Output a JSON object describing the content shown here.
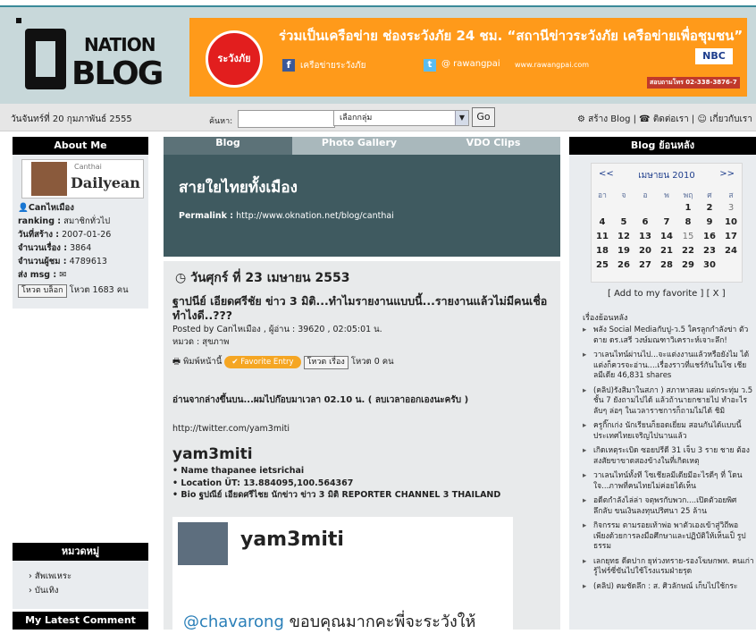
{
  "header": {
    "logo_nation": "NATION",
    "logo_blog": "BLOG",
    "banner_top": "ร่วมเป็นเครือข่าย ช่องระวังภัย 24 ชม. “สถานีข่าวระวังภัย เครือข่ายเพื่อชุมชน”",
    "banner_logo": "ระวังภัย",
    "banner_fb": "เครือข่ายระวังภัย",
    "banner_tw": "@ rawangpai",
    "banner_site": "www.rawangpai.com",
    "banner_nbc": "NBC",
    "banner_phone": "สอบถามโทร 02-338-3876-7"
  },
  "toolbar": {
    "date": "วันจันทร์ที่ 20 กุมภาพันธ์ 2555",
    "search_label": "ค้นหา:",
    "group_select": "เลือกกลุ่ม",
    "go": "Go",
    "link_create": "สร้าง Blog",
    "link_contact": "ติดต่อเรา",
    "link_about": "เกี่ยวกับเรา"
  },
  "left": {
    "about_title": "About Me",
    "profile_small": "Canthai",
    "profile_name_img": "Dailyean",
    "username": "Canไหเมือง",
    "ranking_label": "ranking :",
    "ranking_value": "สมาชิกทั่วไป",
    "created_label": "วันที่สร้าง :",
    "created_value": "2007-01-26",
    "posts_label": "จำนวนเรื่อง :",
    "posts_value": "3864",
    "visitors_label": "จำนวนผู้ชม :",
    "visitors_value": "4789613",
    "msg_label": "ส่ง msg :",
    "vote_button": "โหวต บล็อก",
    "vote_text": "โหวต 1683 คน",
    "category_title": "หมวดหมู่",
    "categories": [
      "สัพเพเหระ",
      "บันเทิง"
    ],
    "latest_title": "My Latest Comment"
  },
  "center": {
    "tabs": [
      "Blog",
      "Photo Gallery",
      "VDO Clips"
    ],
    "blog_title": "สายใยไทยทั้งเมือง",
    "permalink_label": "Permalink :",
    "permalink_url": "http://www.oknation.net/blog/canthai",
    "post_date": "วันศุกร์ ที่ 23 เมษายน 2553",
    "post_title": "ฐาปนีย์ เอียดศรีชัย ข่าว 3 มิติ...ทำไมรายงานแบบนี้...รายงานแล้วไม่มีคนเชื่อทำไงดี..???",
    "post_by": "Posted by Canไหเมือง , ผู้อ่าน : 39620 , 02:05:01 น.",
    "post_category": "หมวด : สุขภาพ",
    "print_label": "พิมพ์หน้านี้",
    "fav_entry": "Favorite Entry",
    "vote_story_button": "โหวต เรื่อง",
    "vote_story_text": "โหวต 0 คน",
    "body1": "อ่านจากล่างขึ้นบน...ผมไปก๊อบมาเวลา 02.10 น. ( ลบเวลาออกเองนะครับ )",
    "twitter_url": "http://twitter.com/yam3miti",
    "yam_head": "yam3miti",
    "yam_items": [
      "Name thapanee ietsrichai",
      "Location ÜT: 13.884095,100.564367",
      "Bio ฐปณีย์ เอียดศรีไชย นักข่าว ข่าว 3 มิติ REPORTER CHANNEL 3 THAILAND"
    ],
    "tweet_name": "yam3miti",
    "tweet_mention": "@chavarong",
    "tweet_text": " ขอบคุณมากคะพี่จะระวังให้"
  },
  "right": {
    "backlog_title": "Blog ย้อนหลัง",
    "cal_prev": "<<",
    "cal_month": "เมษายน 2010",
    "cal_next": ">>",
    "cal_days": [
      "อา",
      "จ",
      "อ",
      "พ",
      "พฤ",
      "ศ",
      "ส"
    ],
    "cal_weeks": [
      [
        "",
        "",
        "",
        "",
        "1",
        "2",
        "3"
      ],
      [
        "4",
        "5",
        "6",
        "7",
        "8",
        "9",
        "10"
      ],
      [
        "11",
        "12",
        "13",
        "14",
        "15",
        "16",
        "17"
      ],
      [
        "18",
        "19",
        "20",
        "21",
        "22",
        "23",
        "24"
      ],
      [
        "25",
        "26",
        "27",
        "28",
        "29",
        "30",
        ""
      ]
    ],
    "fav_links": "[ Add to my favorite ] [ X ]",
    "history_label": "เรื่องย้อนหลัง",
    "history": [
      "พลัง Social Mediaกับปู-ว.5 ใครลูกกำลังข่า ตัวตาย ดร.เสรี วงษ์มณฑาวิเคราะห์เจาะลึก!",
      "วาเลนไทน์ผ่านไป...จะแต่งงานแล้วหรือยังไม ได้แต่งก็ควรจะอ่าน....เรื่องราวที่แชร์กันในโซ เชียลมีเดีย 46,831 shares",
      "(คลิป)รังสิมาในสภา ) สภาหาสลม แต่กระทุ่ม ว.5 ชั้น 7 ยังถามไปได้ แล้วถ้านายกชายไป ทำอะไรลับๆ ล่อๆ ในเวลาราชการก็ถามไม่ได้ ชิมิ",
      "ครูกิ๊กเก่ง นักเรียนก็ยอดเยี่ยม สอนกันได้แบบนี้ ประเทศไทยเจริญไปนานแล้ว",
      "เกิดเหตุระเบิด ซอยปรีดี 31 เจ็บ 3 ราย ชาย ต้องสงสัยขาขาดสองข้างในที่เกิดเหตุ",
      "วาเลนไทน์ทั้งที โซเชียลมีเดียมีอะไรดีๆ ที่ โดนใจ...ภาพที่คนไทยไม่ค่อยได้เห็น",
      "อดีตกำลังไล่ล่า จตุพรกับพวก....เปิดตัวอยพิศ ลึกลับ ขนเงินลงทุนปริศนา 25 ล้าน",
      "กิจกรรม ตามรอยเท้าพ่อ พาตัวเองเข้าสู่วิถีพอ เพียงด้วยการลงมือศึกษาและปฏิบัติให้เห็นเป็ รูปธรรม",
      "เลกยุทธ ดีดปาก ยุห่วงทราย-รองโฆษกพท. คนเก่ารู้ไฟร์ซี่ขันไปใช้โรงแรมฝ่ายรุด",
      "(คลิป) คมชัดลึก : ส. ศิวลักษณ์ เก็บไปใช้กระ"
    ]
  },
  "colors": {
    "header_bg": "#c8d8da",
    "banner_bg": "#ff9a1a",
    "blog_header_bg": "#3f5a60",
    "tab_active": "#5c7278",
    "tab_inactive": "#a9b8bc"
  }
}
